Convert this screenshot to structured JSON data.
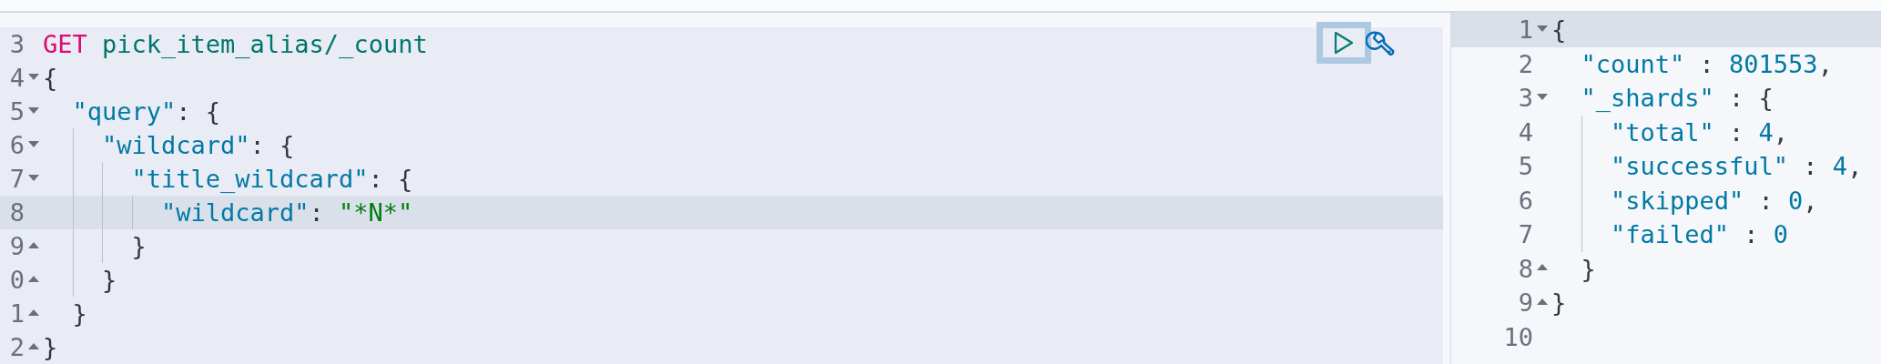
{
  "request_editor": {
    "lines": [
      {
        "number": "3",
        "active": false,
        "kind": "plain",
        "tokens": [
          {
            "kind": "method",
            "text": "GET"
          },
          {
            "kind": "url",
            "text": " pick_item_alias/_count"
          }
        ]
      },
      {
        "number": "4",
        "active": false,
        "kind": "open",
        "tokens": [
          {
            "kind": "punct",
            "text": "{"
          }
        ]
      },
      {
        "number": "5",
        "active": false,
        "kind": "open",
        "tokens": [
          {
            "kind": "key",
            "text": "  \"query\""
          },
          {
            "kind": "punct",
            "text": ": {"
          }
        ]
      },
      {
        "number": "6",
        "active": false,
        "kind": "open",
        "tokens": [
          {
            "kind": "key",
            "text": "    \"wildcard\""
          },
          {
            "kind": "punct",
            "text": ": {"
          }
        ]
      },
      {
        "number": "7",
        "active": false,
        "kind": "open",
        "tokens": [
          {
            "kind": "key",
            "text": "      \"title_wildcard\""
          },
          {
            "kind": "punct",
            "text": ": {"
          }
        ]
      },
      {
        "number": "8",
        "active": true,
        "kind": "plain",
        "tokens": [
          {
            "kind": "key",
            "text": "        \"wildcard\""
          },
          {
            "kind": "punct",
            "text": ": "
          },
          {
            "kind": "string",
            "text": "\"*N*\""
          }
        ]
      },
      {
        "number": "9",
        "active": false,
        "kind": "close",
        "tokens": [
          {
            "kind": "punct",
            "text": "      }"
          }
        ]
      },
      {
        "number": "0",
        "active": false,
        "kind": "close",
        "tokens": [
          {
            "kind": "punct",
            "text": "    }"
          }
        ]
      },
      {
        "number": "1",
        "active": false,
        "kind": "close",
        "tokens": [
          {
            "kind": "punct",
            "text": "  }"
          }
        ]
      },
      {
        "number": "2",
        "active": false,
        "kind": "close",
        "tokens": [
          {
            "kind": "punct",
            "text": "}"
          }
        ]
      }
    ]
  },
  "response_viewer": {
    "lines": [
      {
        "number": "1",
        "active": true,
        "kind": "open",
        "tokens": [
          {
            "kind": "punct",
            "text": "{"
          }
        ]
      },
      {
        "number": "2",
        "active": false,
        "kind": "plain",
        "tokens": [
          {
            "kind": "key",
            "text": "  \"count\""
          },
          {
            "kind": "punct",
            "text": " : "
          },
          {
            "kind": "number",
            "text": "801553"
          },
          {
            "kind": "punct",
            "text": ","
          }
        ]
      },
      {
        "number": "3",
        "active": false,
        "kind": "open",
        "tokens": [
          {
            "kind": "key",
            "text": "  \"_shards\""
          },
          {
            "kind": "punct",
            "text": " : {"
          }
        ]
      },
      {
        "number": "4",
        "active": false,
        "kind": "plain",
        "tokens": [
          {
            "kind": "key",
            "text": "    \"total\""
          },
          {
            "kind": "punct",
            "text": " : "
          },
          {
            "kind": "number",
            "text": "4"
          },
          {
            "kind": "punct",
            "text": ","
          }
        ]
      },
      {
        "number": "5",
        "active": false,
        "kind": "plain",
        "tokens": [
          {
            "kind": "key",
            "text": "    \"successful\""
          },
          {
            "kind": "punct",
            "text": " : "
          },
          {
            "kind": "number",
            "text": "4"
          },
          {
            "kind": "punct",
            "text": ","
          }
        ]
      },
      {
        "number": "6",
        "active": false,
        "kind": "plain",
        "tokens": [
          {
            "kind": "key",
            "text": "    \"skipped\""
          },
          {
            "kind": "punct",
            "text": " : "
          },
          {
            "kind": "number",
            "text": "0"
          },
          {
            "kind": "punct",
            "text": ","
          }
        ]
      },
      {
        "number": "7",
        "active": false,
        "kind": "plain",
        "tokens": [
          {
            "kind": "key",
            "text": "    \"failed\""
          },
          {
            "kind": "punct",
            "text": " : "
          },
          {
            "kind": "number",
            "text": "0"
          }
        ]
      },
      {
        "number": "8",
        "active": false,
        "kind": "close",
        "tokens": [
          {
            "kind": "punct",
            "text": "  }"
          }
        ]
      },
      {
        "number": "9",
        "active": false,
        "kind": "close",
        "tokens": [
          {
            "kind": "punct",
            "text": "}"
          }
        ]
      },
      {
        "number": "10",
        "active": false,
        "kind": "plain"
      }
    ]
  }
}
